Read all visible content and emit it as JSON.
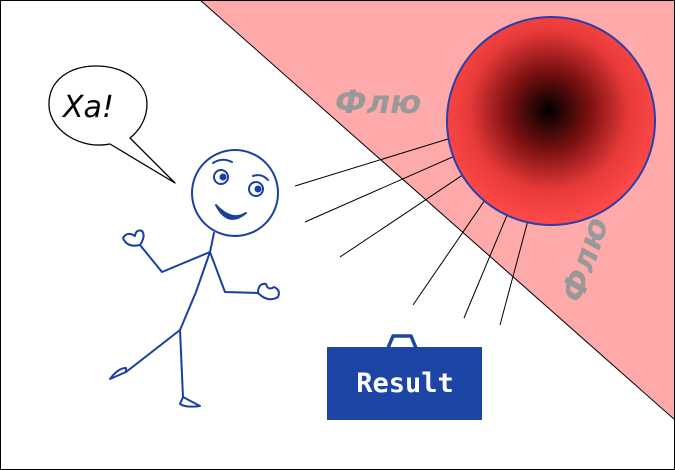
{
  "speech_bubble": {
    "text": "Ха!"
  },
  "flu_labels": {
    "upper": "Флю",
    "lower": "Флю"
  },
  "result_box": {
    "label": "Result"
  },
  "colors": {
    "figure_stroke": "#1a3fa0",
    "danger_zone": "#ffaaaa",
    "orb_outer": "#ff4a4a",
    "orb_core": "#000000",
    "flu_text": "#999999",
    "result_fill": "#1c45a6"
  }
}
